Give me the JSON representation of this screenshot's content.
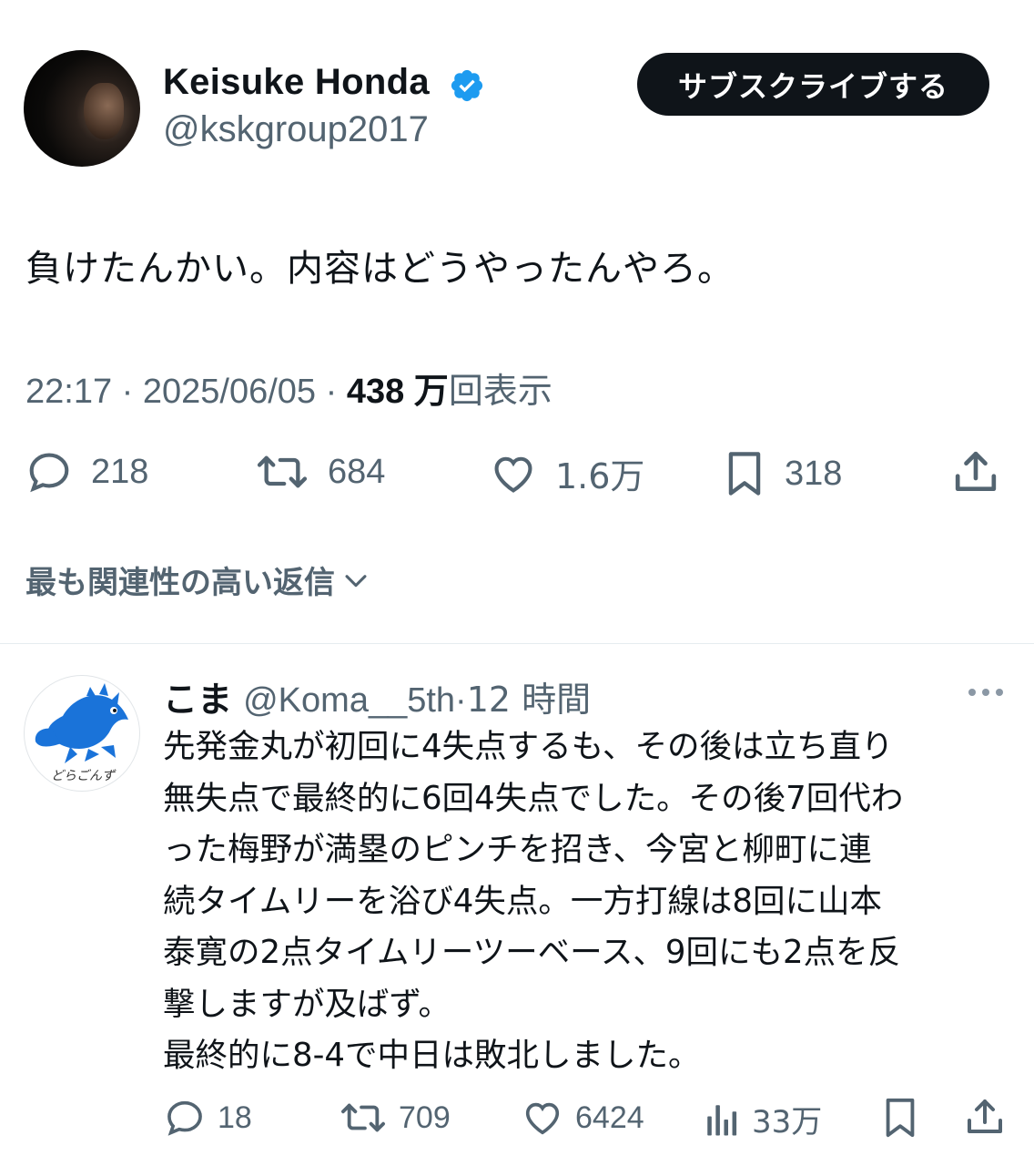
{
  "tweet": {
    "author": {
      "display_name": "Keisuke Honda",
      "handle": "@kskgroup2017",
      "verified": true
    },
    "subscribe_label": "サブスクライブする",
    "text": "負けたんかい。内容はどうやったんやろ。",
    "time": "22:17",
    "date": "2025/06/05",
    "separator": "·",
    "views_count": "438 万",
    "views_label": "回表示",
    "actions": {
      "replies": "218",
      "retweets": "684",
      "likes": "1.6万",
      "bookmarks": "318"
    }
  },
  "sort": {
    "label": "最も関連性の高い返信"
  },
  "reply": {
    "display_name": "こま",
    "handle": "@Koma__5th",
    "separator": "·",
    "time": "12 時間",
    "avatar_text": "どらごんず",
    "lines": [
      "先発金丸が初回に4失点するも、その後は立ち直り",
      "無失点で最終的に6回4失点でした。その後7回代わ",
      "った梅野が満塁のピンチを招き、今宮と柳町に連",
      "続タイムリーを浴び4失点。一方打線は8回に山本",
      "泰寛の2点タイムリーツーベース、9回にも2点を反",
      "撃しますが及ばず。",
      "最終的に8-4で中日は敗北しました。"
    ],
    "actions": {
      "replies": "18",
      "retweets": "709",
      "likes": "6424",
      "views": "33万"
    }
  },
  "colors": {
    "text_primary": "#0f1419",
    "text_secondary": "#536471",
    "verified_blue": "#1d9bf0",
    "button_bg": "#0f1419",
    "mascot_blue": "#1a73d9"
  }
}
